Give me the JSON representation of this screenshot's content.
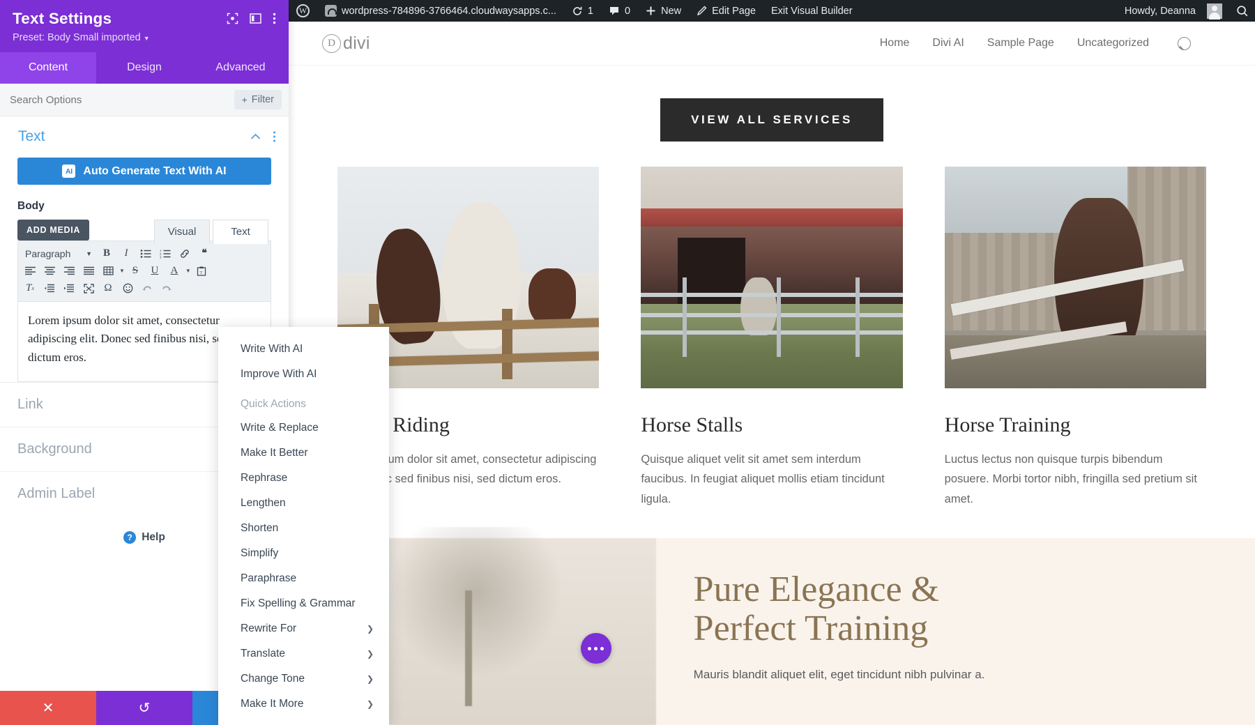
{
  "adminbar": {
    "site_url": "wordpress-784896-3766464.cloudwaysapps.c...",
    "updates_count": "1",
    "comments_count": "0",
    "new_label": "New",
    "edit_page_label": "Edit Page",
    "exit_builder_label": "Exit Visual Builder",
    "howdy": "Howdy, Deanna"
  },
  "site": {
    "brand_mark": "D",
    "brand_text": "divi",
    "nav": [
      "Home",
      "Divi AI",
      "Sample Page",
      "Uncategorized"
    ],
    "cta": "VIEW ALL SERVICES",
    "services": [
      {
        "title": "Horse Riding",
        "body": "Lorem ipsum dolor sit amet, consectetur adipiscing elit. Donec sed finibus nisi, sed dictum eros."
      },
      {
        "title": "Horse Stalls",
        "body": "Quisque aliquet velit sit amet sem interdum faucibus. In feugiat aliquet mollis etiam tincidunt ligula."
      },
      {
        "title": "Horse Training",
        "body": "Luctus lectus non quisque turpis bibendum posuere. Morbi tortor nibh, fringilla sed pretium sit amet."
      }
    ],
    "band": {
      "title_line1": "Pure Elegance &",
      "title_line2": "Perfect Training",
      "subtitle": "Mauris blandit aliquet elit, eget tincidunt nibh pulvinar a."
    }
  },
  "panel": {
    "title": "Text Settings",
    "preset": "Preset: Body Small imported",
    "tabs": [
      {
        "label": "Content",
        "active": true
      },
      {
        "label": "Design",
        "active": false
      },
      {
        "label": "Advanced",
        "active": false
      }
    ],
    "search_placeholder": "Search Options",
    "filter_label": "Filter",
    "section_title": "Text",
    "ai_button": "Auto Generate Text With AI",
    "ai_badge": "AI",
    "body_label": "Body",
    "add_media": "ADD MEDIA",
    "editor_tabs": [
      "Visual",
      "Text"
    ],
    "format_select": "Paragraph",
    "editor_content": "Lorem ipsum dolor sit amet, consectetur adipiscing elit. Donec sed finibus nisi, sed dictum eros.",
    "accordions": [
      "Link",
      "Background",
      "Admin Label"
    ],
    "help_label": "Help",
    "inline_ai_badge": "AI",
    "footer": {
      "cancel": "✕",
      "undo": "↺",
      "redo": "↻"
    },
    "accent_purple": "#7b2fd4",
    "accent_blue": "#2a87d8"
  },
  "ai_menu": {
    "items": [
      {
        "label": "Write With AI",
        "submenu": false,
        "muted": false
      },
      {
        "label": "Improve With AI",
        "submenu": false,
        "muted": false
      },
      {
        "label": "Quick Actions",
        "submenu": false,
        "muted": true
      },
      {
        "label": "Write & Replace",
        "submenu": false,
        "muted": false
      },
      {
        "label": "Make It Better",
        "submenu": false,
        "muted": false
      },
      {
        "label": "Rephrase",
        "submenu": false,
        "muted": false
      },
      {
        "label": "Lengthen",
        "submenu": false,
        "muted": false
      },
      {
        "label": "Shorten",
        "submenu": false,
        "muted": false
      },
      {
        "label": "Simplify",
        "submenu": false,
        "muted": false
      },
      {
        "label": "Paraphrase",
        "submenu": false,
        "muted": false
      },
      {
        "label": "Fix Spelling & Grammar",
        "submenu": false,
        "muted": false
      },
      {
        "label": "Rewrite For",
        "submenu": true,
        "muted": false
      },
      {
        "label": "Translate",
        "submenu": true,
        "muted": false
      },
      {
        "label": "Change Tone",
        "submenu": true,
        "muted": false
      },
      {
        "label": "Make It More",
        "submenu": true,
        "muted": false
      }
    ],
    "arrow_glyph": "❯"
  },
  "toolbar_rows": [
    [
      "bold",
      "italic",
      "bullet-list",
      "numbered-list",
      "link",
      "blockquote"
    ],
    [
      "align-left",
      "align-center",
      "align-right",
      "justify",
      "table",
      "strikethrough",
      "underline",
      "text-color"
    ],
    [
      "clear-formatting",
      "outdent",
      "indent",
      "fullscreen",
      "special-character",
      "emoji",
      "undo",
      "redo",
      "paste-as-text"
    ]
  ]
}
